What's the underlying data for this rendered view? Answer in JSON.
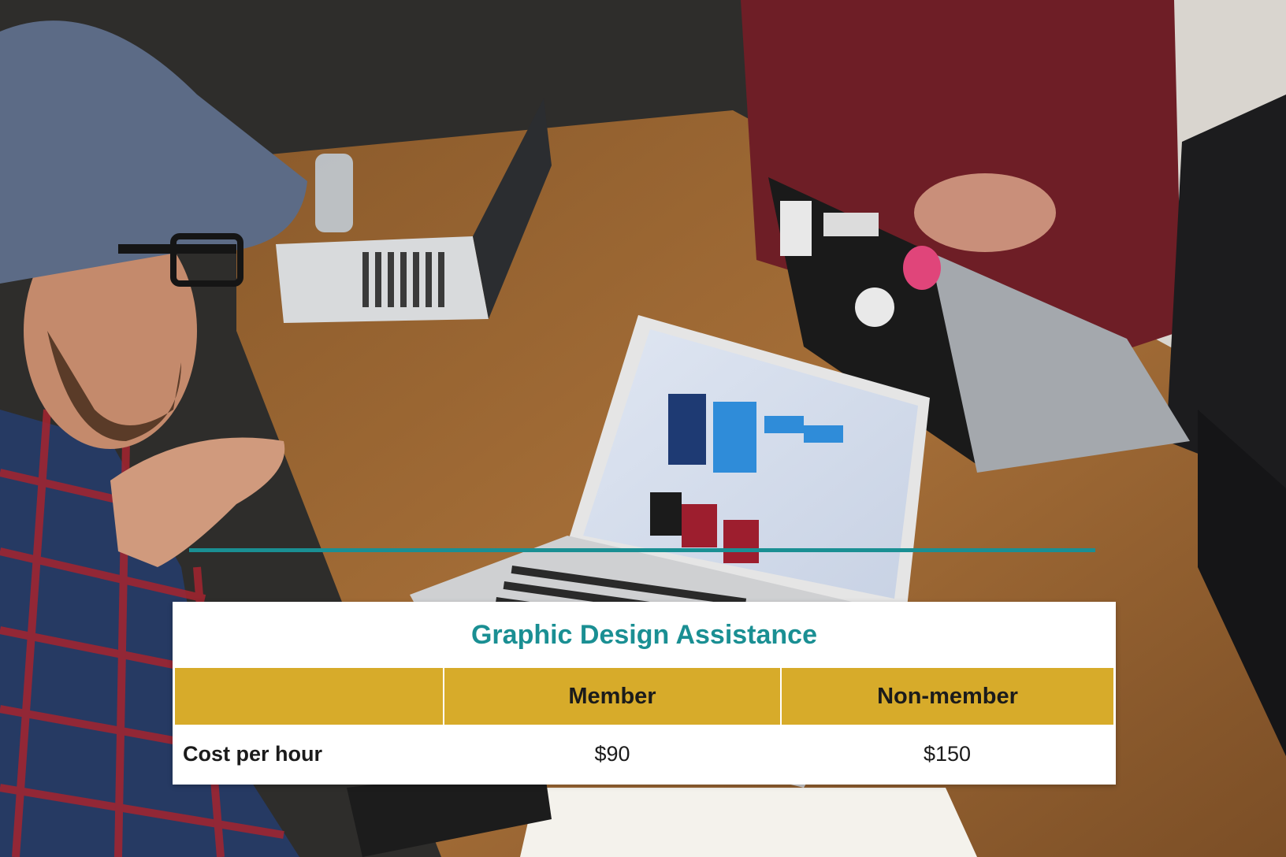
{
  "pricing": {
    "title": "Graphic Design Assistance",
    "columns": [
      "",
      "Member",
      "Non-member"
    ],
    "rows": [
      {
        "label": "Cost per hour",
        "values": [
          "$90",
          "$150"
        ]
      }
    ]
  },
  "colors": {
    "accent": "#1a8f93",
    "header_bg": "#d7ab2a",
    "card_bg": "#ffffff",
    "text": "#1b1b1b"
  }
}
